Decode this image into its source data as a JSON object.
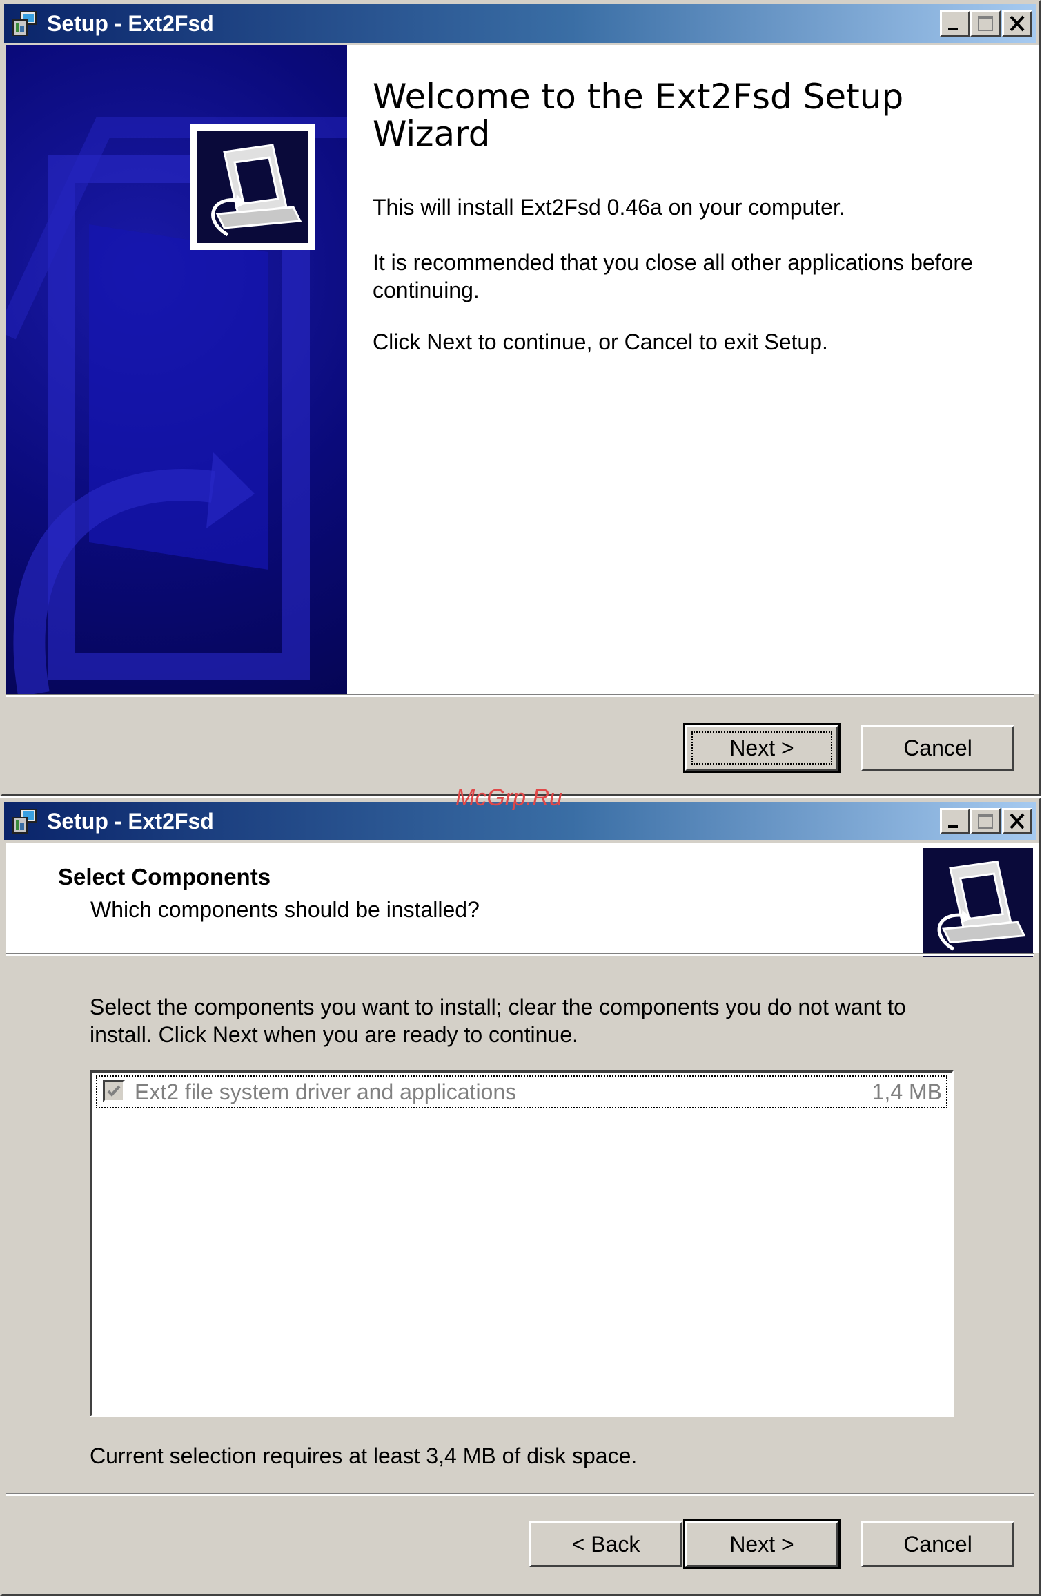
{
  "watermark": "McGrp.Ru",
  "window1": {
    "title": "Setup - Ext2Fsd",
    "heading": "Welcome to the Ext2Fsd Setup Wizard",
    "para1": "This will install Ext2Fsd 0.46a on your computer.",
    "para2": "It is recommended that you close all other applications before continuing.",
    "para3": "Click Next to continue, or Cancel to exit Setup.",
    "next_label": "Next >",
    "cancel_label": "Cancel"
  },
  "window2": {
    "title": "Setup - Ext2Fsd",
    "header_title": "Select Components",
    "header_subtitle": "Which components should be installed?",
    "instructions": "Select the components you want to install; clear the components you do not want to install. Click Next when you are ready to continue.",
    "components": [
      {
        "label": "Ext2 file system driver and applications",
        "size": "1,4 MB",
        "checked": true,
        "enabled": false
      }
    ],
    "disk_space": "Current selection requires at least 3,4 MB of disk space.",
    "back_label": "< Back",
    "next_label": "Next >",
    "cancel_label": "Cancel"
  },
  "colors": {
    "titlebar_start": "#0a246a",
    "titlebar_end": "#a6caf0",
    "banner": "#0a0a7a",
    "dialog_face": "#d4d0c8"
  }
}
